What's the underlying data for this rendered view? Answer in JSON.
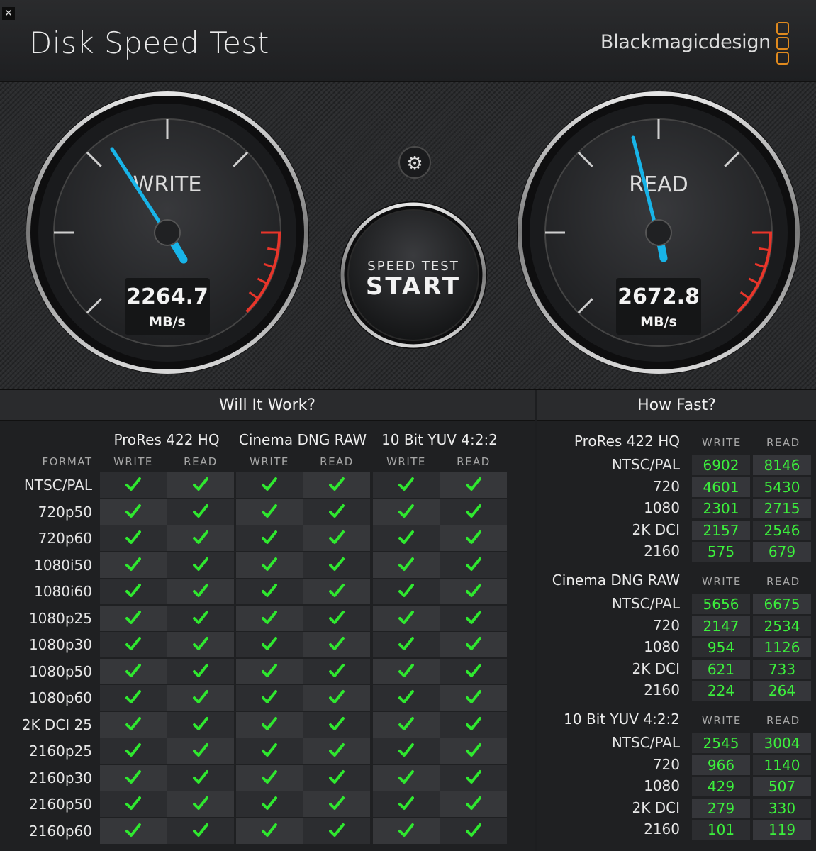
{
  "app": {
    "title": "Disk Speed Test",
    "brand": "Blackmagicdesign",
    "close_glyph": "✕",
    "accent_color": "#e08a1e"
  },
  "gauges": {
    "write": {
      "label": "WRITE",
      "value": "2264.7",
      "unit": "MB/s"
    },
    "read": {
      "label": "READ",
      "value": "2672.8",
      "unit": "MB/s"
    },
    "needle_color": "#18b4e8",
    "redline_color": "#e8352a"
  },
  "start_button": {
    "line1": "SPEED TEST",
    "line2": "START"
  },
  "settings_icon": "gear-icon",
  "will_it_work": {
    "title": "Will It Work?",
    "format_label": "FORMAT",
    "write_label": "WRITE",
    "read_label": "READ",
    "groups": [
      "ProRes 422 HQ",
      "Cinema DNG RAW",
      "10 Bit YUV 4:2:2"
    ],
    "formats": [
      "NTSC/PAL",
      "720p50",
      "720p60",
      "1080i50",
      "1080i60",
      "1080p25",
      "1080p30",
      "1080p50",
      "1080p60",
      "2K DCI 25",
      "2160p25",
      "2160p30",
      "2160p50",
      "2160p60"
    ],
    "check_color": "#2fe82f"
  },
  "how_fast": {
    "title": "How Fast?",
    "write_label": "WRITE",
    "read_label": "READ",
    "groups": [
      {
        "name": "ProRes 422 HQ",
        "rows": [
          {
            "label": "NTSC/PAL",
            "write": "6902",
            "read": "8146"
          },
          {
            "label": "720",
            "write": "4601",
            "read": "5430"
          },
          {
            "label": "1080",
            "write": "2301",
            "read": "2715"
          },
          {
            "label": "2K DCI",
            "write": "2157",
            "read": "2546"
          },
          {
            "label": "2160",
            "write": "575",
            "read": "679"
          }
        ]
      },
      {
        "name": "Cinema DNG RAW",
        "rows": [
          {
            "label": "NTSC/PAL",
            "write": "5656",
            "read": "6675"
          },
          {
            "label": "720",
            "write": "2147",
            "read": "2534"
          },
          {
            "label": "1080",
            "write": "954",
            "read": "1126"
          },
          {
            "label": "2K DCI",
            "write": "621",
            "read": "733"
          },
          {
            "label": "2160",
            "write": "224",
            "read": "264"
          }
        ]
      },
      {
        "name": "10 Bit YUV 4:2:2",
        "rows": [
          {
            "label": "NTSC/PAL",
            "write": "2545",
            "read": "3004"
          },
          {
            "label": "720",
            "write": "966",
            "read": "1140"
          },
          {
            "label": "1080",
            "write": "429",
            "read": "507"
          },
          {
            "label": "2K DCI",
            "write": "279",
            "read": "330"
          },
          {
            "label": "2160",
            "write": "101",
            "read": "119"
          }
        ]
      }
    ]
  }
}
